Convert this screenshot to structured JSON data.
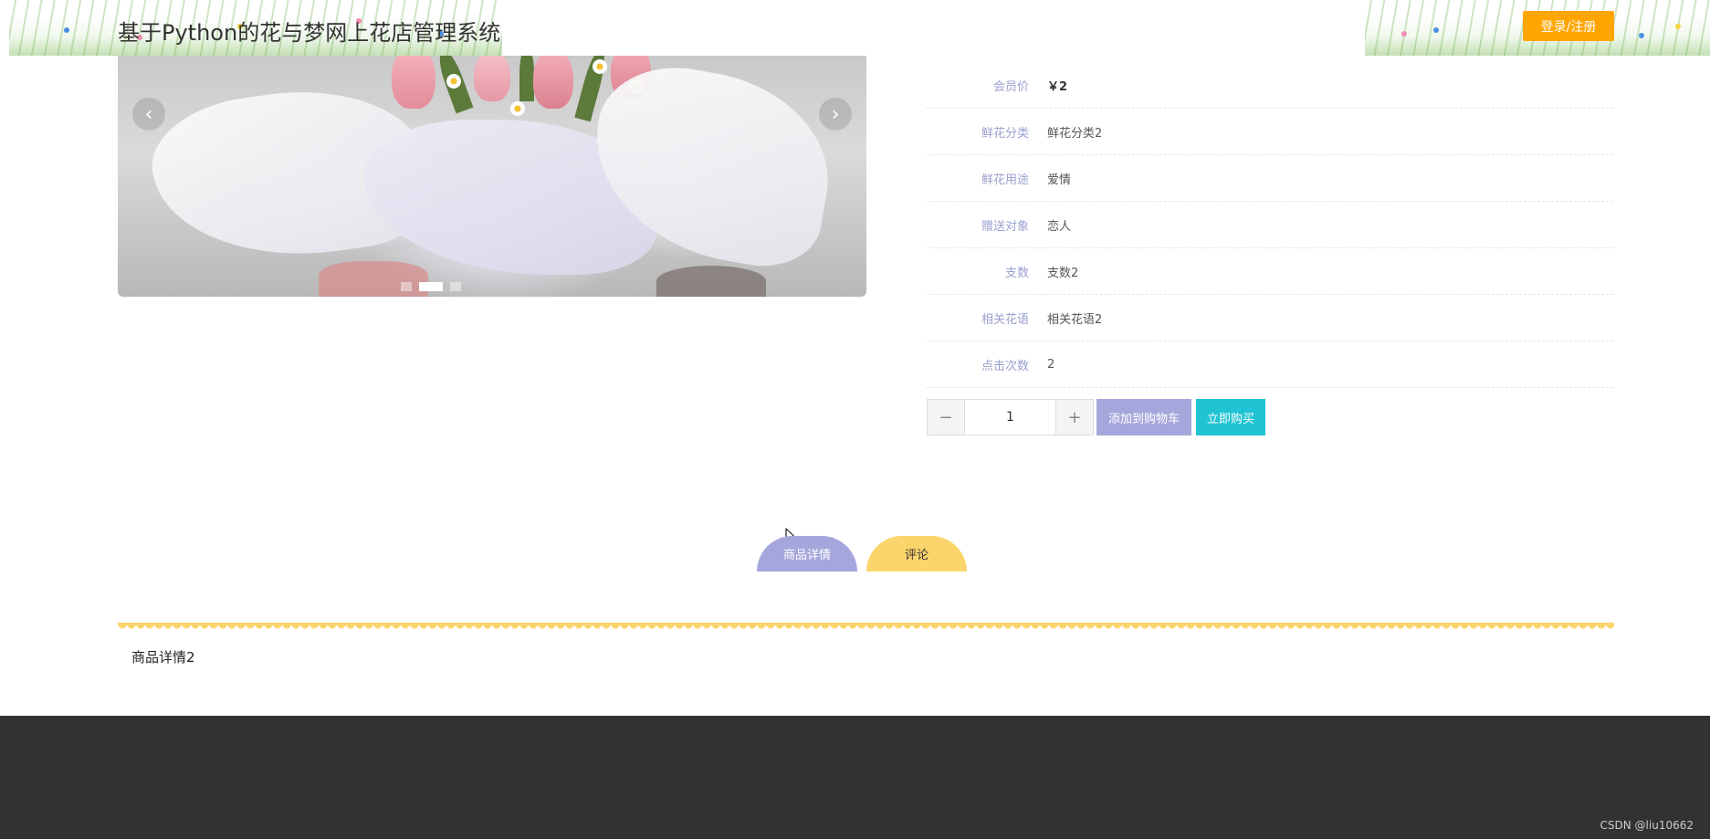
{
  "header": {
    "title": "基于Python的花与梦网上花店管理系统",
    "login_label": "登录/注册"
  },
  "carousel": {
    "prev_glyph": "‹",
    "next_glyph": "›",
    "slide_count": 3,
    "active_index": 1
  },
  "product": {
    "rows": [
      {
        "label": "会员价",
        "value": "￥2"
      },
      {
        "label": "鲜花分类",
        "value": "鲜花分类2"
      },
      {
        "label": "鲜花用途",
        "value": "爱情"
      },
      {
        "label": "赠送对象",
        "value": "恋人"
      },
      {
        "label": "支数",
        "value": "支数2"
      },
      {
        "label": "相关花语",
        "value": "相关花语2"
      },
      {
        "label": "点击次数",
        "value": "2"
      }
    ],
    "quantity": "1",
    "minus_glyph": "−",
    "plus_glyph": "+",
    "add_to_cart_label": "添加到购物车",
    "buy_now_label": "立即购买"
  },
  "tabs": [
    {
      "label": "商品详情",
      "active": true
    },
    {
      "label": "评论",
      "active": false
    }
  ],
  "detail_content": "商品详情2",
  "footer": {
    "watermark": "CSDN @liu10662"
  },
  "colors": {
    "accent_orange": "#ffa500",
    "accent_purple": "#a5a7dc",
    "accent_cyan": "#1fc3d3",
    "accent_yellow": "#fbd56b",
    "footer_bg": "#323232"
  }
}
